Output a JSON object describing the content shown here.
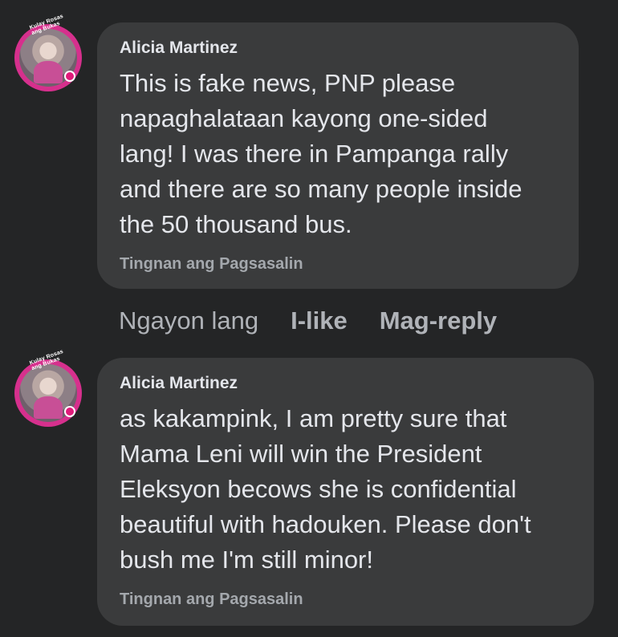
{
  "comments": [
    {
      "avatar_ring_text": "Kulay Rosas ang Bukas",
      "author": "Alicia Martinez",
      "text": "This is fake news, PNP please\nnapaghalataan kayong one-sided\nlang! I was there in Pampanga rally\nand there are so many people inside\nthe 50 thousand bus.",
      "translation_link": "Tingnan ang Pagsasalin",
      "time": "Ngayon lang",
      "like": "I-like",
      "reply": "Mag-reply"
    },
    {
      "avatar_ring_text": "Kulay Rosas ang Bukas",
      "author": "Alicia Martinez",
      "text": "as kakampink, I am pretty sure that\nMama Leni will win the President\nEleksyon becows she is confidential\nbeautiful with hadouken. Please don't\nbush me I'm still minor!",
      "translation_link": "Tingnan ang Pagsasalin"
    }
  ],
  "colors": {
    "background": "#242526",
    "bubble": "#3a3b3c",
    "text": "#e4e6eb",
    "secondary": "#b0b3b8",
    "avatar_ring": "#d6308d"
  }
}
